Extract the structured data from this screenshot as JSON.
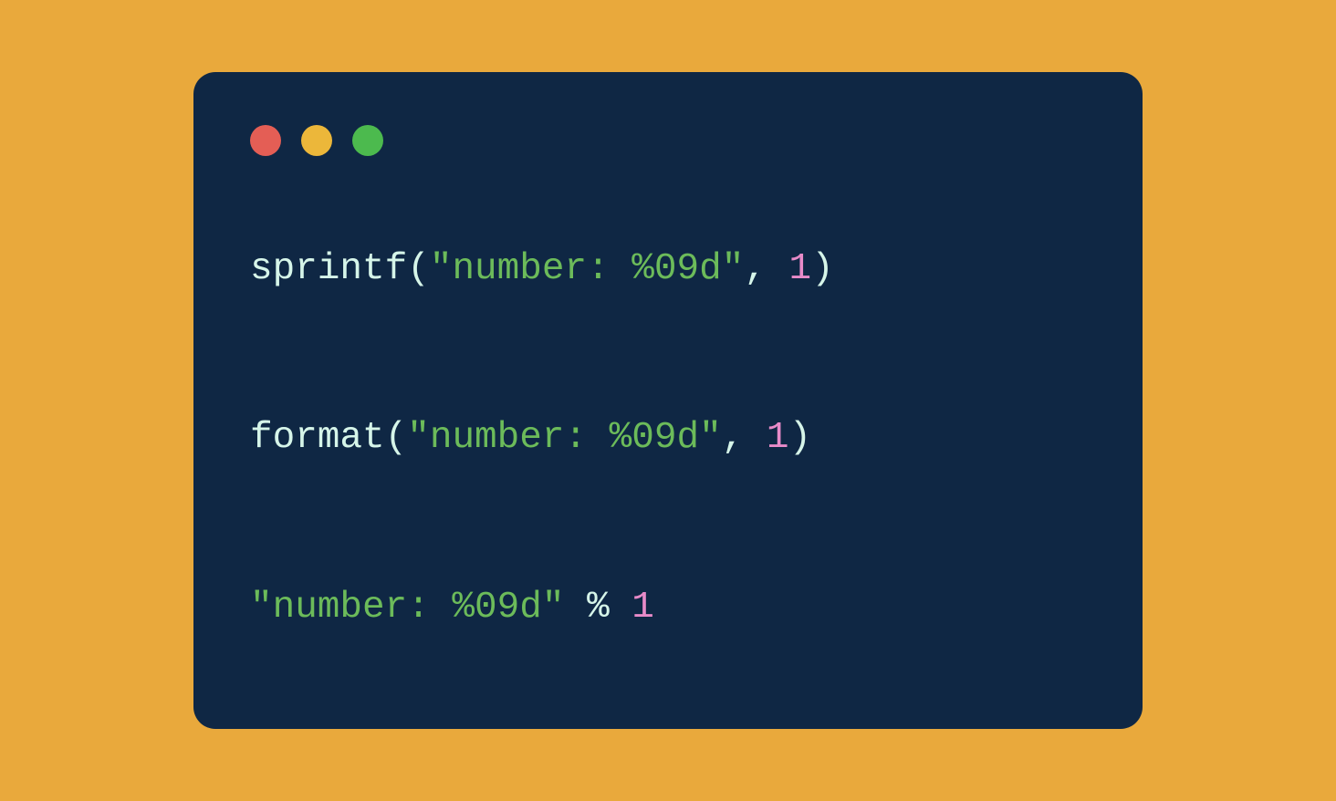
{
  "colors": {
    "background": "#e9a93c",
    "window": "#0f2744",
    "traffic_red": "#e45e55",
    "traffic_yellow": "#ecb73a",
    "traffic_green": "#4cba4e",
    "func": "#d6f5e9",
    "string": "#6cbb5a",
    "number": "#e88bc9"
  },
  "code": {
    "line1": {
      "func": "sprintf",
      "open": "(",
      "string": "\"number: %09d\"",
      "comma": ",",
      "space": " ",
      "number": "1",
      "close": ")"
    },
    "line2": {
      "func": "format",
      "open": "(",
      "string": "\"number: %09d\"",
      "comma": ",",
      "space": " ",
      "number": "1",
      "close": ")"
    },
    "line3": {
      "string": "\"number: %09d\"",
      "space1": " ",
      "op": "%",
      "space2": " ",
      "number": "1"
    }
  }
}
